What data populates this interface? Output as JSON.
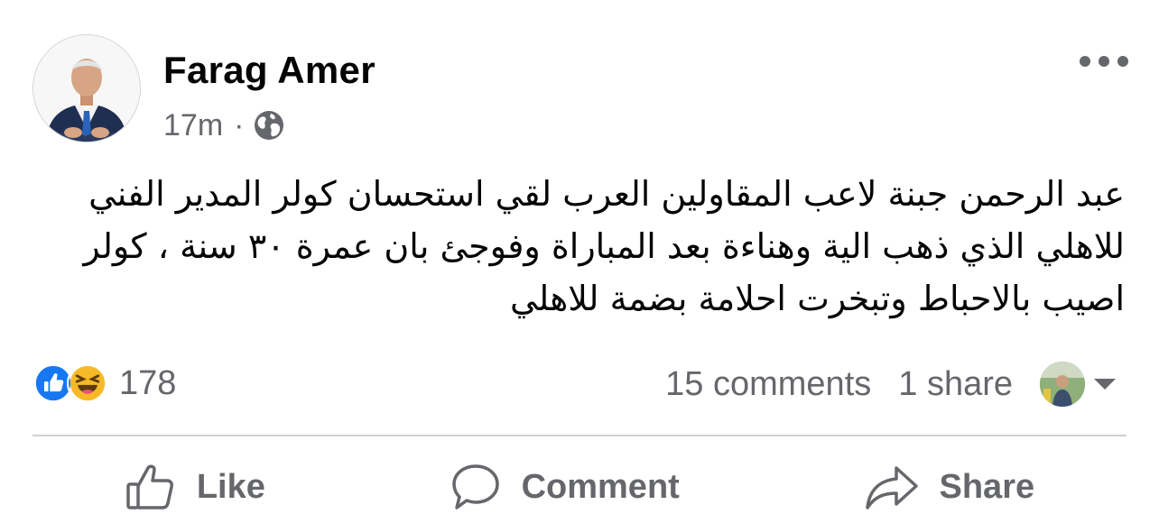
{
  "post": {
    "author": "Farag Amer",
    "time": "17m",
    "separator": "·",
    "privacy_icon": "globe-icon",
    "more_icon": "more-options-icon",
    "text": "عبد الرحمن جبنة لاعب المقاولين العرب لقي استحسان كولر المدير الفني للاهلي الذي ذهب الية وهناءة بعد المباراة وفوجئ بان عمرة ٣٠ سنة ، كولر اصيب بالاحباط وتبخرت احلامة بضمة للاهلي"
  },
  "reactions": {
    "types": [
      "like-reaction-icon",
      "haha-reaction-icon"
    ],
    "count": "178"
  },
  "stats": {
    "comments": "15 comments",
    "shares": "1 share"
  },
  "actions": {
    "like": "Like",
    "comment": "Comment",
    "share": "Share"
  },
  "colors": {
    "secondary_text": "#65676b",
    "like_blue": "#1877f2",
    "haha_yellow": "#f7b928",
    "divider": "#ced0d4"
  }
}
